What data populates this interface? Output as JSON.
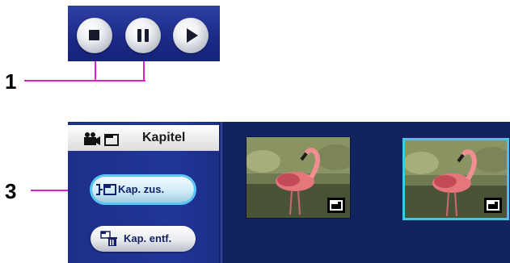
{
  "callouts": [
    {
      "number": "1"
    },
    {
      "number": "3"
    }
  ],
  "transport": {
    "buttons": [
      {
        "icon": "stop-icon"
      },
      {
        "icon": "pause-icon"
      },
      {
        "icon": "play-icon"
      }
    ]
  },
  "chapter_editor": {
    "header": {
      "title": "Kapitel",
      "icon": "camera-chapter-icon"
    },
    "buttons": [
      {
        "label": "Kap. zus.",
        "icon": "add-chapter-icon",
        "state": "selected"
      },
      {
        "label": "Kap. entf.",
        "icon": "delete-chapter-icon",
        "state": "normal"
      }
    ],
    "thumbnails": [
      {
        "content": "flamingo",
        "chapter_marker": true,
        "selected": false
      },
      {
        "content": "flamingo",
        "chapter_marker": true,
        "selected": true
      }
    ]
  },
  "colors": {
    "callout_line": "#e020d0",
    "panel_blue": "#1b2a86",
    "selection_cyan": "#42c6ea"
  }
}
